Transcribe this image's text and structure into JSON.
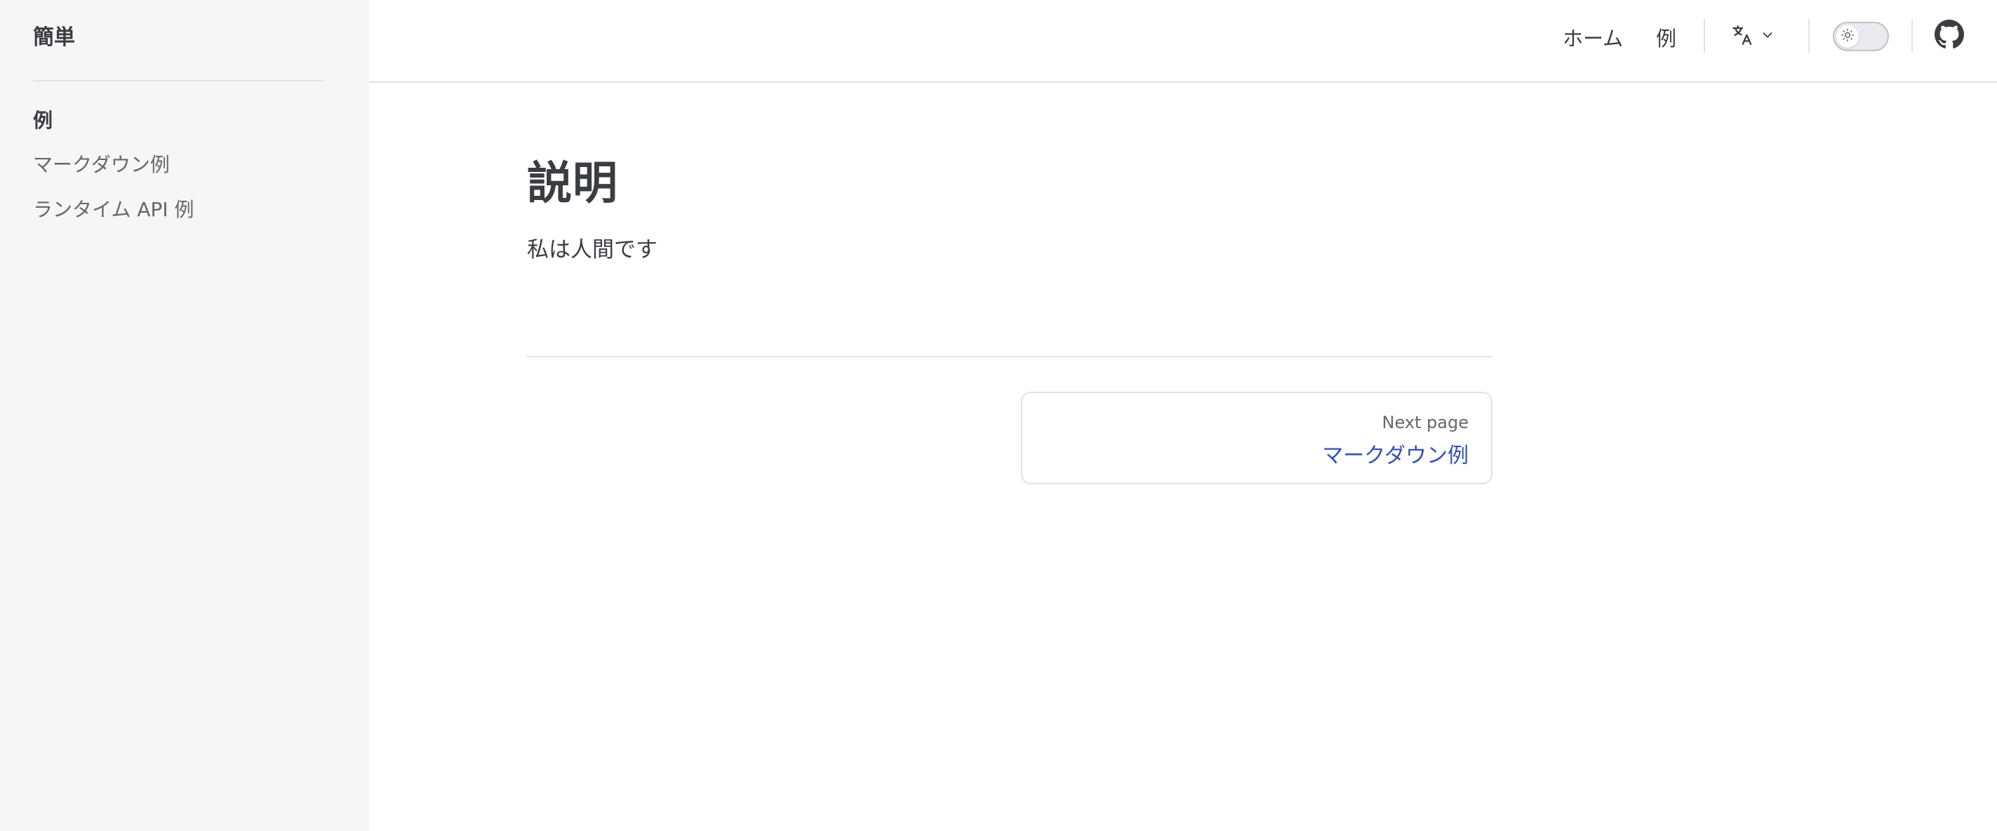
{
  "sidebar": {
    "site_title": "簡単",
    "group_title": "例",
    "items": [
      {
        "label": "マークダウン例"
      },
      {
        "label": "ランタイム API 例"
      }
    ]
  },
  "topbar": {
    "nav": [
      {
        "label": "ホーム"
      },
      {
        "label": "例"
      }
    ],
    "language_icon": "translate-icon",
    "theme_icon": "sun-icon",
    "github_icon": "github-icon"
  },
  "main": {
    "title": "説明",
    "body": "私は人間です",
    "next": {
      "label": "Next page",
      "title": "マークダウン例"
    }
  },
  "colors": {
    "sidebar_bg": "#f6f6f7",
    "text": "#3c3c43",
    "muted": "#67676c",
    "link": "#3451b2",
    "divider": "#e2e2e3"
  }
}
